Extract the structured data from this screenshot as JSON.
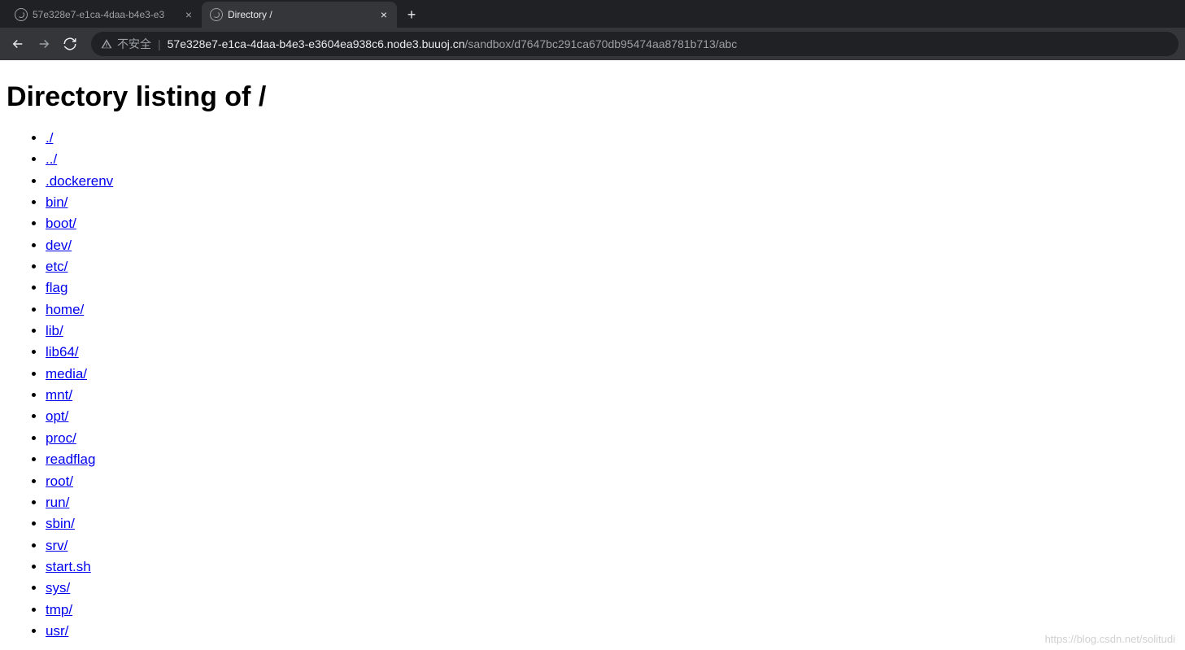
{
  "tabs": [
    {
      "title": "57e328e7-e1ca-4daa-b4e3-e3",
      "active": false
    },
    {
      "title": "Directory /",
      "active": true
    }
  ],
  "toolbar": {
    "security_label": "不安全",
    "url_main": "57e328e7-e1ca-4daa-b4e3-e3604ea938c6.node3.buuoj.cn",
    "url_path": "/sandbox/d7647bc291ca670db95474aa8781b713/abc"
  },
  "page": {
    "heading": "Directory listing of /",
    "entries": [
      "./",
      "../",
      ".dockerenv",
      "bin/",
      "boot/",
      "dev/",
      "etc/",
      "flag",
      "home/",
      "lib/",
      "lib64/",
      "media/",
      "mnt/",
      "opt/",
      "proc/",
      "readflag",
      "root/",
      "run/",
      "sbin/",
      "srv/",
      "start.sh",
      "sys/",
      "tmp/",
      "usr/"
    ]
  },
  "watermark": "https://blog.csdn.net/solitudi"
}
